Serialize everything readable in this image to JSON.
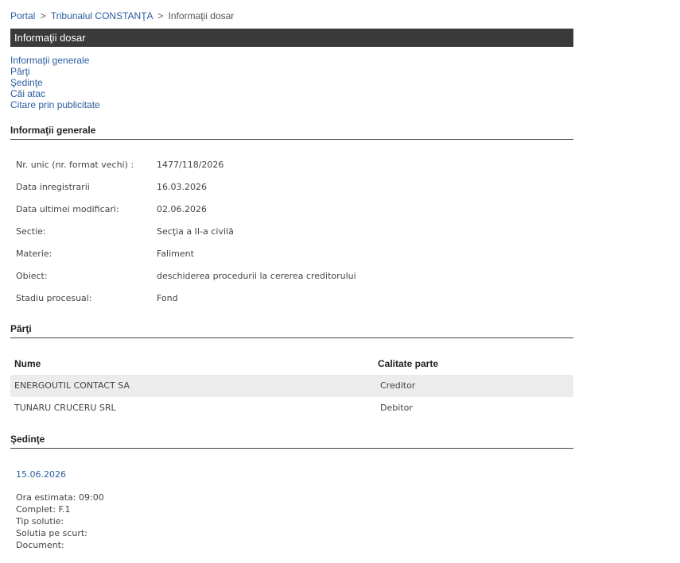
{
  "breadcrumb": {
    "portal": "Portal",
    "court": "Tribunalul CONSTANŢA",
    "current": "Informaţii dosar",
    "separator": ">"
  },
  "title_bar": "Informaţii dosar",
  "nav_links": [
    "Informaţii generale",
    "Părţi",
    "Şedinţe",
    "Căi atac",
    "Citare prin publicitate"
  ],
  "info_section": {
    "heading": "Informaţii generale",
    "rows": [
      {
        "label": "Nr. unic (nr. format vechi) :",
        "value": "1477/118/2026"
      },
      {
        "label": "Data inregistrarii",
        "value": "16.03.2026"
      },
      {
        "label": "Data ultimei modificari:",
        "value": "02.06.2026"
      },
      {
        "label": "Sectie:",
        "value": "Secţia a II-a civilă"
      },
      {
        "label": "Materie:",
        "value": "Faliment"
      },
      {
        "label": "Obiect:",
        "value": "deschiderea procedurii la cererea creditorului"
      },
      {
        "label": "Stadiu procesual:",
        "value": "Fond"
      }
    ]
  },
  "parti_section": {
    "heading": "Părţi",
    "col_name": "Nume",
    "col_role": "Calitate parte",
    "rows": [
      {
        "name": "ENERGOUTIL CONTACT SA",
        "role": "Creditor"
      },
      {
        "name": "TUNARU CRUCERU SRL",
        "role": "Debitor"
      }
    ]
  },
  "sedinte_section": {
    "heading": "Şedinţe",
    "date": "15.06.2026",
    "lines": [
      "Ora estimata: 09:00",
      "Complet: F.1",
      "Tip solutie:",
      "Solutia pe scurt:",
      "Document:"
    ]
  }
}
